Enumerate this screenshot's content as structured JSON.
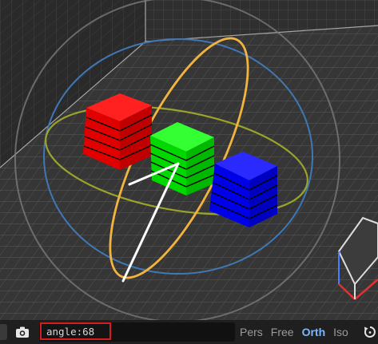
{
  "viewport": {
    "gizmo_colors": {
      "x_ring": "#9aa32a",
      "y_ring": "#f3b33f",
      "z_ring": "#3f78b5",
      "outer_ring": "#7a7a7a"
    },
    "objects": [
      {
        "name": "red-block",
        "color": "#ff0000"
      },
      {
        "name": "green-block",
        "color": "#00e000"
      },
      {
        "name": "blue-block",
        "color": "#0000ff"
      }
    ]
  },
  "statusbar": {
    "camera_icon": "camera-icon",
    "command_value": "angle:68",
    "view_modes": [
      {
        "label": "Pers",
        "active": false
      },
      {
        "label": "Free",
        "active": false
      },
      {
        "label": "Orth",
        "active": true
      },
      {
        "label": "Iso",
        "active": false
      }
    ],
    "reset_icon": "rotate-reset-icon"
  }
}
